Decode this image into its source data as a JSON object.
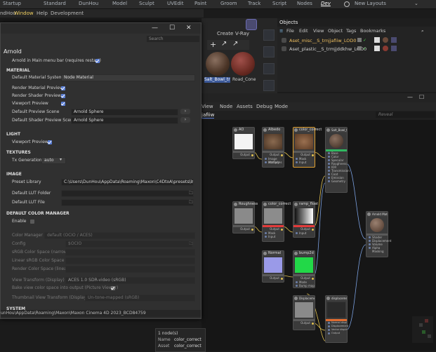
{
  "layouts": [
    "Startup",
    "Standard",
    "DunHou",
    "Model",
    "Sculpt",
    "UVEdit",
    "Paint",
    "Groom",
    "Track",
    "Script",
    "Nodes",
    "Dev",
    "New Layouts"
  ],
  "active_layout": "Dev",
  "app_menu": [
    "ndHou",
    "Window",
    "Help",
    "Development"
  ],
  "viewport": {
    "create_label": "Create",
    "vray_label": "V-Ray",
    "mat1": "Salt_Bowl_tr",
    "mat2": "Road_Cone"
  },
  "objects": {
    "tab": "Objects",
    "menu": [
      "File",
      "Edit",
      "View",
      "Object",
      "Tags",
      "Bookmarks"
    ],
    "rows": [
      {
        "name": "Aset_misc__S_trnjjafiiw_LOD0"
      },
      {
        "name": "Aset_plastic__S_trmjjddkhw_LOD0"
      }
    ]
  },
  "node_editor": {
    "menu": [
      "View",
      "Node",
      "Assets",
      "Debug",
      "Mode"
    ],
    "tab": "jafiiw",
    "search": "Reveal"
  },
  "nodes": {
    "ao": {
      "title": "AO",
      "out": "Output"
    },
    "albedo": {
      "title": "Albedo",
      "out": "Output",
      "in1": "Image attributes",
      "in2": "Multiply"
    },
    "cc1": {
      "title": "color_correct",
      "out": "Output",
      "in1": "Mask",
      "in2": "Input"
    },
    "std": {
      "title": "Salt_Bowl_trnjafiiw Stad...",
      "in": [
        "Base",
        "Color",
        "Specular",
        "Roughness",
        "IOR",
        "Transmission",
        "Coat",
        "Emission",
        "Geometry"
      ]
    },
    "rough": {
      "title": "Roughness",
      "out": "Output"
    },
    "cc2": {
      "title": "color_correct",
      "out": "Output",
      "in1": "Mask",
      "in2": "Input"
    },
    "ramp": {
      "title": "ramp_float",
      "out": "Output",
      "in1": "Input"
    },
    "arnold_mat": {
      "title": "Arnold Material",
      "in": [
        "Shader",
        "Displacement",
        "Volume",
        "Alpha Masking"
      ]
    },
    "normal": {
      "title": "Normal",
      "out": "Output"
    },
    "bump": {
      "title": "bump2d",
      "out": "Output",
      "in1": "Bump map",
      "in2": "Mode"
    },
    "disp": {
      "title": "Displacement",
      "out": "Output"
    },
    "displacement": {
      "title": "displacement",
      "in": [
        "Normal displace...",
        "Displacement",
        "Vector displacem...",
        "Output"
      ]
    }
  },
  "info": {
    "count": "1 node(s)",
    "name_label": "Name",
    "name_value": "color_correct",
    "asset_label": "Asset",
    "asset_value": "color_correct"
  },
  "dialog": {
    "title_partial": "",
    "search_placeholder": "Search",
    "heading": "Arnold",
    "main_menu_label": "Arnold in Main menu bar (requires restart)",
    "material": {
      "section": "MATERIAL",
      "default_system_label": "Default Material System",
      "default_system_value": "Node Material",
      "render_material_preview": "Render Material Preview",
      "render_shader_previews": "Render Shader Previews",
      "viewport_preview": "Viewport Preview",
      "default_preview_scene_label": "Default Preview Scene",
      "default_preview_scene_value": "Arnold Sphere",
      "default_shader_preview_scene_label": "Default Shader Preview Scene",
      "default_shader_preview_scene_value": "Arnold Sphere"
    },
    "light": {
      "section": "LIGHT",
      "viewport_preview": "Viewport Preview"
    },
    "textures": {
      "section": "TEXTURES",
      "tx_generation_label": "Tx Generation",
      "tx_generation_value": "auto"
    },
    "image": {
      "section": "IMAGE",
      "preset_library_label": "Preset Library",
      "preset_library_value": "C:\\Users\\DunHou\\AppData\\Roaming\\Maxon\\C4DtoA\\presets\\image",
      "default_lut_folder_label": "Default LUT Folder",
      "default_lut_file_label": "Default LUT File"
    },
    "color_manager": {
      "section": "DEFAULT COLOR MANAGER",
      "enable_label": "Enable",
      "manager_label": "Color Manager",
      "manager_value": "default (OCIO / ACES)",
      "config_label": "Config",
      "config_value": "$OCIO",
      "srgb_narrow": "sRGB Color Space (narrow)",
      "linear_srgb": "Linear sRGB Color Space",
      "render_cs": "Render Color Space (linear)",
      "view_transform_label": "View Transform (Display)",
      "view_transform_value": "ACES 1.0 SDR-video (sRGB)",
      "bake_label": "Bake view color space into output (Picture Viewer)",
      "thumb_label": "Thumbnail View Transform (Display)",
      "thumb_value": "Un-tone-mapped (sRGB)"
    },
    "system_section": "SYSTEM",
    "path_status": "unHou\\AppData\\Roaming\\Maxon\\Maxon Cinema 4D 2023_BCD84759"
  },
  "colors": {
    "accent": "#5b7fd6",
    "selected_node": "#e0a030",
    "wire": "#e0c050",
    "albedo_bar": "#e23b3b",
    "std_bar": "#30b860"
  }
}
